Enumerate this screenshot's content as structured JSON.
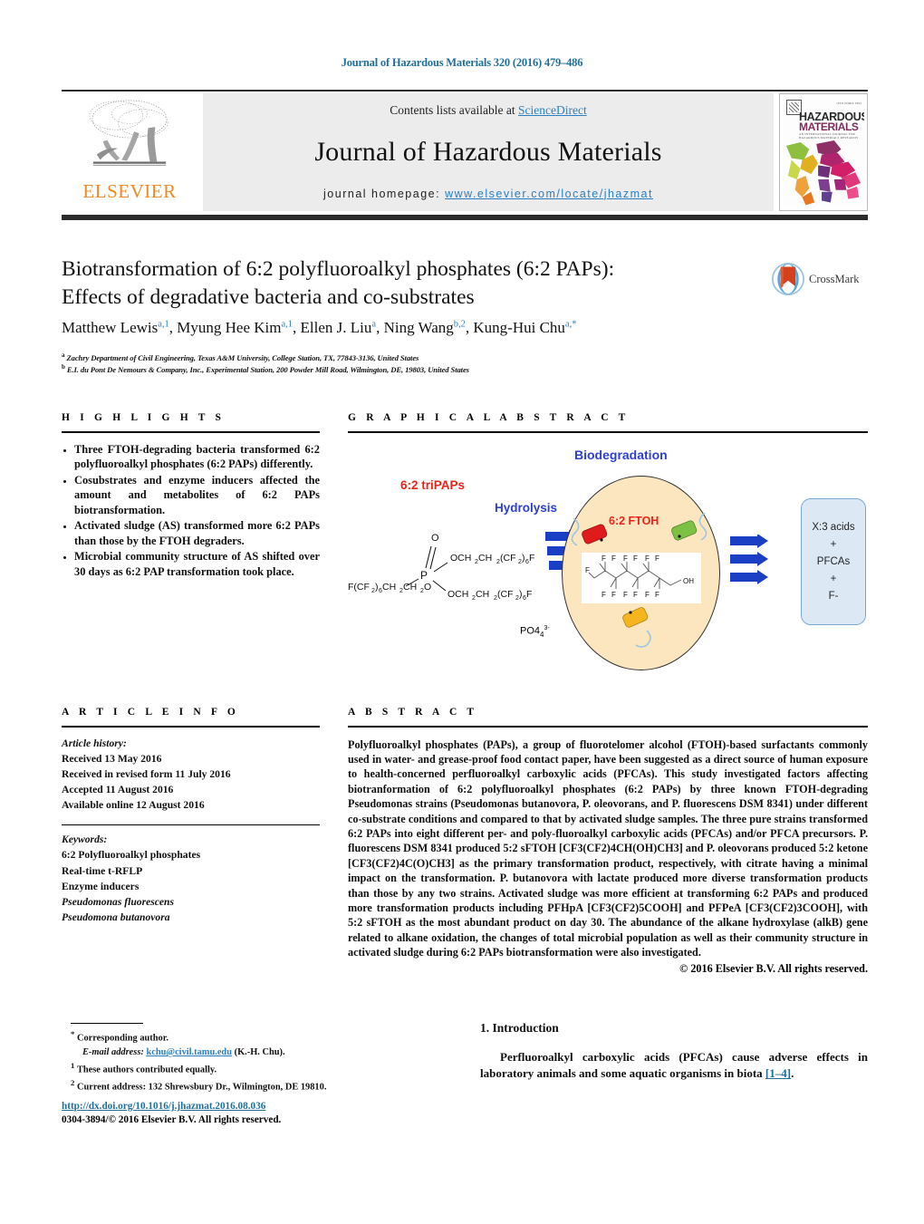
{
  "running_head": "Journal of Hazardous Materials 320 (2016) 479–486",
  "masthead": {
    "contents_prefix": "Contents lists available at ",
    "sciencedirect": "ScienceDirect",
    "journal_name": "Journal of Hazardous Materials",
    "homepage_prefix": "journal homepage: ",
    "homepage_url": "www.elsevier.com/locate/jhazmat",
    "publisher": "ELSEVIER",
    "cover": {
      "line1": "HAZARDOUS",
      "line2": "MATERIALS",
      "tiny_top": "ISSN 00ORE 3894",
      "subtitle": "AN INTERNATIONAL JOURNAL FOR HAZARDOUS MATERIALS RESEARCH"
    }
  },
  "article": {
    "title_line1": "Biotransformation of 6:2 polyfluoroalkyl phosphates (6:2 PAPs):",
    "title_line2": "Effects of degradative bacteria and co-substrates",
    "crossmark_label": "CrossMark",
    "authors": [
      {
        "name": "Matthew Lewis",
        "sup": "a,1",
        "sep": ", "
      },
      {
        "name": "Myung Hee Kim",
        "sup": "a,1",
        "sep": ", "
      },
      {
        "name": "Ellen J. Liu",
        "sup": "a",
        "sep": ", "
      },
      {
        "name": "Ning Wang",
        "sup": "b,2",
        "sep": ", "
      },
      {
        "name": "Kung-Hui Chu",
        "sup": "a,*",
        "sep": ""
      }
    ],
    "affiliations": [
      {
        "mark": "a",
        "text": "Zachry Department of Civil Engineering, Texas A&M University, College Station, TX, 77843-3136, United States"
      },
      {
        "mark": "b",
        "text": "E.I. du Pont De Nemours & Company, Inc., Experimental Station, 200 Powder Mill Road, Wilmington, DE, 19803, United States"
      }
    ]
  },
  "highlights": {
    "heading": "H I G H L I G H T S",
    "items": [
      "Three FTOH-degrading bacteria transformed 6:2 polyfluoroalkyl phosphates (6:2 PAPs) differently.",
      "Cosubstrates and enzyme inducers affected the amount and metabolites of 6:2 PAPs biotransformation.",
      "Activated sludge (AS) transformed more 6:2 PAPs than those by the FTOH degraders.",
      "Microbial community structure of AS shifted over 30 days as 6:2 PAP transformation took place."
    ]
  },
  "graphical_abstract": {
    "heading": "G R A P H I C A L   A B S T R A C T",
    "labels": {
      "biodegradation": "Biodegradation",
      "tripaps": "6:2 triPAPs",
      "hydrolysis": "Hydrolysis",
      "ftoh": "6:2 FTOH",
      "phosphate": "PO4",
      "phosphate_charge": "3-"
    },
    "formula": {
      "double_bond_o": "O",
      "center": "P",
      "left_chain": "F(CF2)6CH2CH2O",
      "top_chain": "OCH2CH2(CF2)6F",
      "bottom_chain": "OCH2CH2(CF2)6F"
    },
    "products_box": [
      "X:3 acids",
      "+",
      "PFCAs",
      "+",
      "F-"
    ],
    "colors": {
      "cell_fill": "#fbe6c0",
      "box_fill": "#dce9f5",
      "arrow": "#1b3fc4",
      "red_text": "#e8231a",
      "blue_text": "#2b3fd0"
    }
  },
  "article_info": {
    "heading": "A R T I C L E   I N F O",
    "history_label": "Article history:",
    "history": [
      "Received 13 May 2016",
      "Received in revised form 11 July 2016",
      "Accepted 11 August 2016",
      "Available online 12 August 2016"
    ],
    "keywords_label": "Keywords:",
    "keywords": [
      "6:2 Polyfluoroalkyl phosphates",
      "Real-time t-RFLP",
      "Enzyme inducers",
      "Pseudomonas fluorescens",
      "Pseudomona butanovora"
    ]
  },
  "abstract": {
    "heading": "A B S T R A C T",
    "text": "Polyfluoroalkyl phosphates (PAPs), a group of fluorotelomer alcohol (FTOH)-based surfactants commonly used in water- and grease-proof food contact paper, have been suggested as a direct source of human exposure to health-concerned perfluoroalkyl carboxylic acids (PFCAs). This study investigated factors affecting biotranformation of 6:2 polyfluoroalkyl phosphates (6:2 PAPs) by three known FTOH-degrading Pseudomonas strains (Pseudomonas butanovora, P. oleovorans, and P. fluorescens DSM 8341) under different co-substrate conditions and compared to that by activated sludge samples. The three pure strains transformed 6:2 PAPs into eight different per- and poly-fluoroalkyl carboxylic acids (PFCAs) and/or PFCA precursors. P. fluorescens DSM 8341 produced 5:2 sFTOH [CF3(CF2)4CH(OH)CH3] and P. oleovorans produced 5:2 ketone [CF3(CF2)4C(O)CH3] as the primary transformation product, respectively, with citrate having a minimal impact on the transformation. P. butanovora with lactate produced more diverse transformation products than those by any two strains. Activated sludge was more efficient at transforming 6:2 PAPs and produced more transformation products including PFHpA [CF3(CF2)5COOH] and PFPeA [CF3(CF2)3COOH], with 5:2 sFTOH as the most abundant product on day 30. The abundance of the alkane hydroxylase (alkB) gene related to alkane oxidation, the changes of total microbial population as well as their community structure in activated sludge during 6:2 PAPs biotransformation were also investigated.",
    "copyright": "© 2016 Elsevier B.V. All rights reserved."
  },
  "footnotes": {
    "corresponding": "Corresponding author.",
    "email_label": "E-mail address:",
    "email": "kchu@civil.tamu.edu",
    "email_suffix": "(K.-H. Chu).",
    "note1": "These authors contributed equally.",
    "note2": "Current address: 132 Shrewsbury Dr., Wilmington, DE 19810."
  },
  "doi_block": {
    "doi": "http://dx.doi.org/10.1016/j.jhazmat.2016.08.036",
    "issn": "0304-3894/© 2016 Elsevier B.V. All rights reserved."
  },
  "introduction": {
    "heading": "1. Introduction",
    "paragraph_pre": "Perfluoroalkyl carboxylic acids (PFCAs) cause adverse effects in laboratory animals and some aquatic organisms in biota ",
    "citation": "[1–4]",
    "paragraph_post": "."
  }
}
